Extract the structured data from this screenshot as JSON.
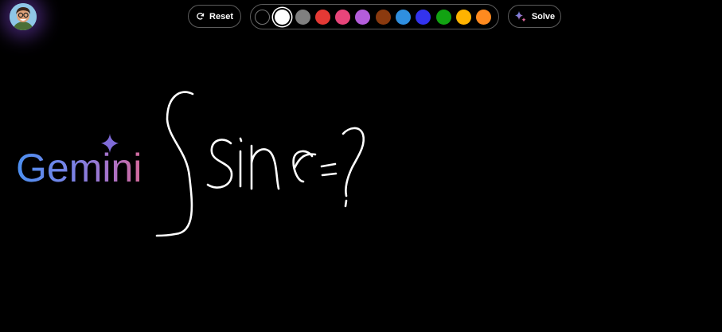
{
  "toolbar": {
    "reset_label": "Reset",
    "solve_label": "Solve",
    "palette": [
      {
        "name": "black",
        "color": "#000000"
      },
      {
        "name": "white",
        "color": "#ffffff",
        "selected": true
      },
      {
        "name": "gray",
        "color": "#808080"
      },
      {
        "name": "red",
        "color": "#e53935"
      },
      {
        "name": "pink",
        "color": "#e8457a"
      },
      {
        "name": "purple",
        "color": "#b45ddb"
      },
      {
        "name": "brown",
        "color": "#8b3a0f"
      },
      {
        "name": "blue",
        "color": "#2f8fe0"
      },
      {
        "name": "indigo",
        "color": "#3333ee"
      },
      {
        "name": "green",
        "color": "#12a312"
      },
      {
        "name": "yellow",
        "color": "#ffb300"
      },
      {
        "name": "orange",
        "color": "#ff8a1f"
      }
    ]
  },
  "canvas": {
    "logo_text": "Gemini",
    "drawing": "∫ sin x = ?",
    "stroke_color": "#ffffff"
  },
  "user": {
    "avatar": "avatar-image"
  }
}
